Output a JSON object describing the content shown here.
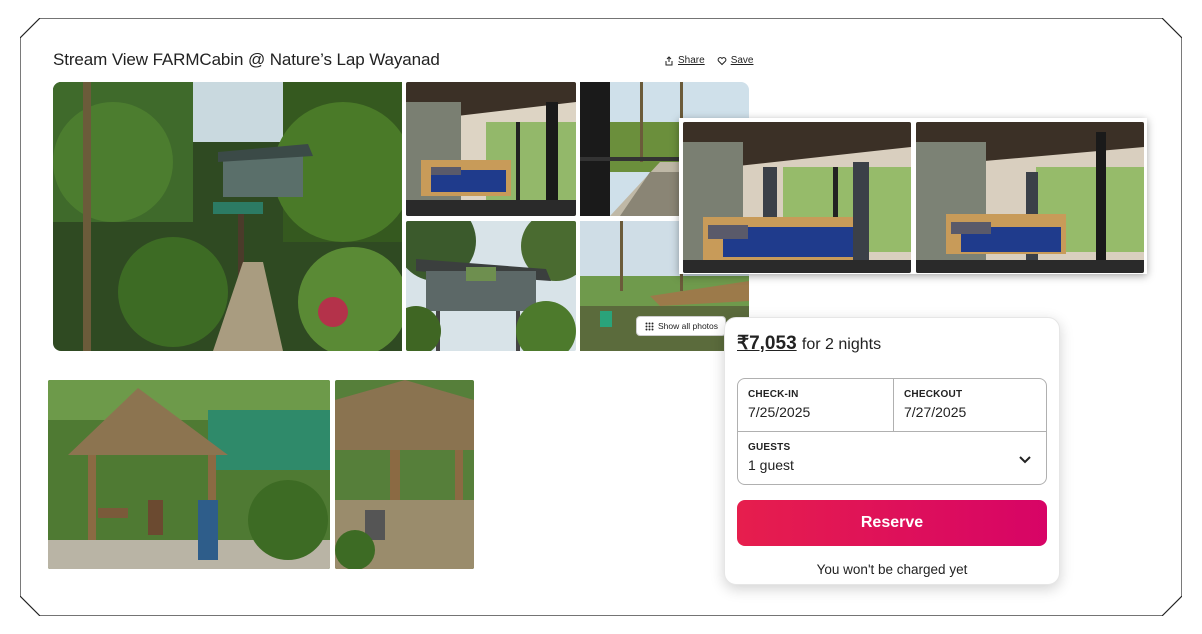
{
  "listing": {
    "title": "Stream View FARMCabin @ Nature’s Lap Wayanad",
    "share_label": "Share",
    "save_label": "Save",
    "show_all_label": "Show all photos"
  },
  "icons": {
    "share": "share-icon",
    "save": "heart-icon",
    "grid": "grid-icon",
    "chevron": "chevron-down-icon"
  },
  "booking": {
    "price": "₹7,053",
    "price_suffix": "for 2 nights",
    "checkin_label": "CHECK-IN",
    "checkin_value": "7/25/2025",
    "checkout_label": "CHECKOUT",
    "checkout_value": "7/27/2025",
    "guests_label": "GUESTS",
    "guests_value": "1 guest",
    "reserve_label": "Reserve",
    "note": "You won't be charged yet"
  },
  "colors": {
    "accent_start": "#e61e4d",
    "accent_end": "#d70466"
  }
}
